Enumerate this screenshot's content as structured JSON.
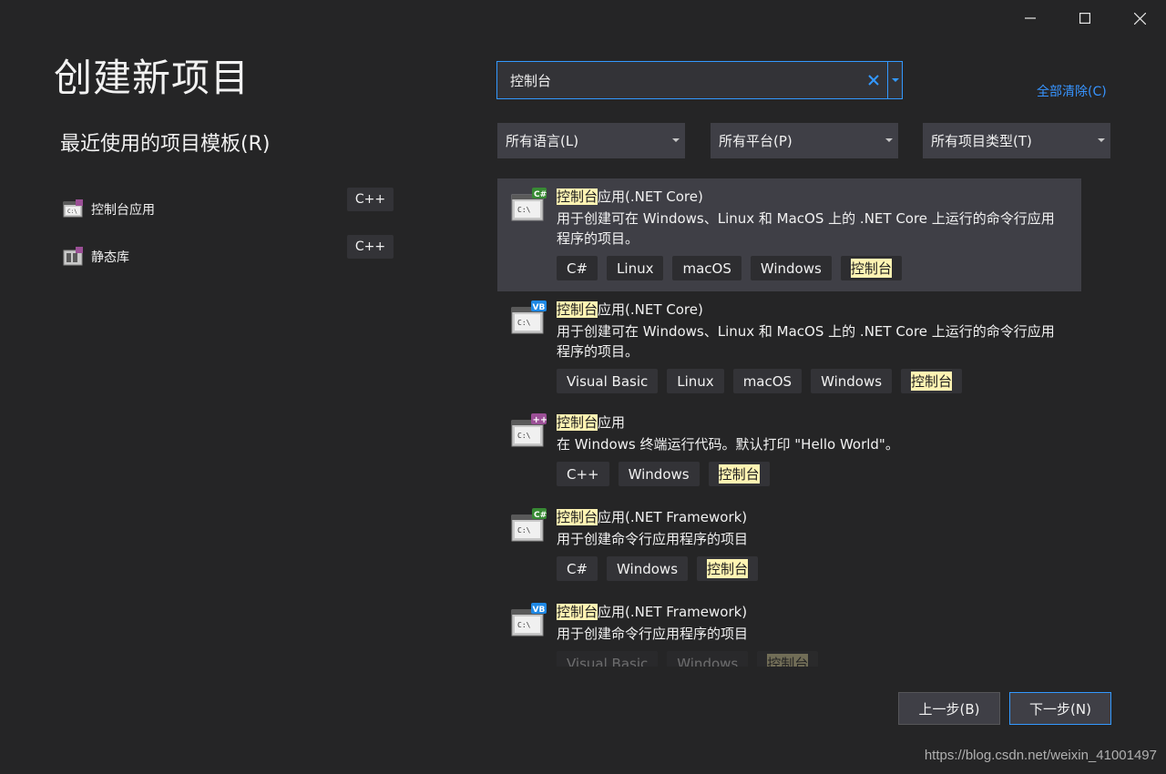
{
  "window": {
    "minimize_icon": "minimize-icon",
    "maximize_icon": "maximize-icon",
    "close_icon": "close-icon"
  },
  "page_title": "创建新项目",
  "recent": {
    "heading": "最近使用的项目模板(R)",
    "items": [
      {
        "label": "控制台应用",
        "tag": "C++",
        "icon": "console-app-icon"
      },
      {
        "label": "静态库",
        "tag": "C++",
        "icon": "static-library-icon"
      }
    ]
  },
  "search": {
    "value": "控制台",
    "placeholder": "",
    "clear_icon": "clear-icon",
    "dropdown_icon": "chevron-down-icon"
  },
  "clear_all_label": "全部清除(C)",
  "filters": {
    "language": "所有语言(L)",
    "platform": "所有平台(P)",
    "project_type": "所有项目类型(T)"
  },
  "results": [
    {
      "highlight": "控制台",
      "title_rest": "应用(.NET Core)",
      "description": "用于创建可在 Windows、Linux 和 MacOS 上的 .NET Core 上运行的命令行应用程序的项目。",
      "language_badge": "C#",
      "tags": [
        "C#",
        "Linux",
        "macOS",
        "Windows"
      ],
      "highlight_tag": "控制台"
    },
    {
      "highlight": "控制台",
      "title_rest": "应用(.NET Core)",
      "description": "用于创建可在 Windows、Linux 和 MacOS 上的 .NET Core 上运行的命令行应用程序的项目。",
      "language_badge": "VB",
      "tags": [
        "Visual Basic",
        "Linux",
        "macOS",
        "Windows"
      ],
      "highlight_tag": "控制台"
    },
    {
      "highlight": "控制台",
      "title_rest": "应用",
      "description": "在 Windows 终端运行代码。默认打印 \"Hello World\"。",
      "language_badge": "++",
      "tags": [
        "C++",
        "Windows"
      ],
      "highlight_tag": "控制台"
    },
    {
      "highlight": "控制台",
      "title_rest": "应用(.NET Framework)",
      "description": "用于创建命令行应用程序的项目",
      "language_badge": "C#",
      "tags": [
        "C#",
        "Windows"
      ],
      "highlight_tag": "控制台"
    },
    {
      "highlight": "控制台",
      "title_rest": "应用(.NET Framework)",
      "description": "用于创建命令行应用程序的项目",
      "language_badge": "VB",
      "tags": [
        "Visual Basic",
        "Windows"
      ],
      "highlight_tag": "控制台"
    }
  ],
  "buttons": {
    "back": "上一步(B)",
    "next": "下一步(N)"
  },
  "watermark": "https://blog.csdn.net/weixin_41001497",
  "colors": {
    "background": "#252526",
    "accent": "#3399ff",
    "highlight": "#fff4b3",
    "csharp_badge": "#388a34",
    "vb_badge": "#1e88e5",
    "cpp_badge": "#9b4f96"
  }
}
